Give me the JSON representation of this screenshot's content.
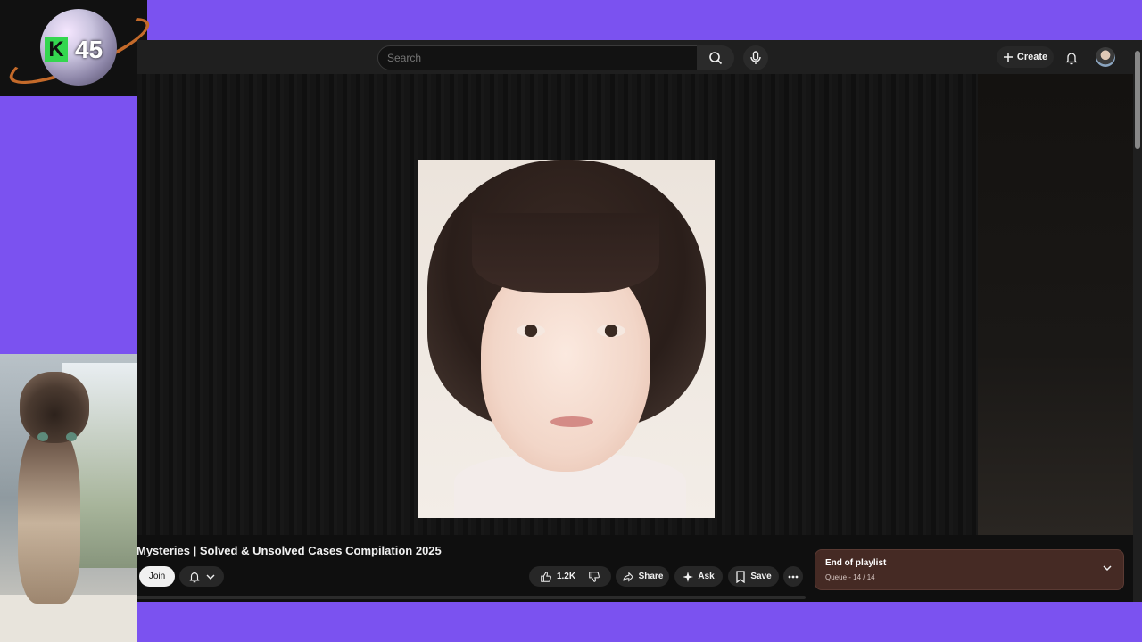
{
  "overlay": {
    "badge_letter": "K",
    "badge_number": "45"
  },
  "youtube": {
    "search": {
      "placeholder": "Search"
    },
    "header": {
      "create_label": "Create"
    },
    "video": {
      "title": "Mysteries | Solved & Unsolved Cases Compilation 2025",
      "join_label": "Join",
      "likes": "1.2K",
      "share_label": "Share",
      "ask_label": "Ask",
      "save_label": "Save"
    },
    "playlist": {
      "title": "End of playlist",
      "subtitle": "Queue - 14 / 14"
    }
  },
  "colors": {
    "background": "#7b52f0",
    "playlist_bg": "#452a24"
  },
  "icons": [
    "search-icon",
    "mic-icon",
    "plus-icon",
    "bell-icon",
    "avatar",
    "like-icon",
    "dislike-icon",
    "share-icon",
    "sparkle-icon",
    "bookmark-icon",
    "more-icon",
    "chevron-down-icon"
  ]
}
